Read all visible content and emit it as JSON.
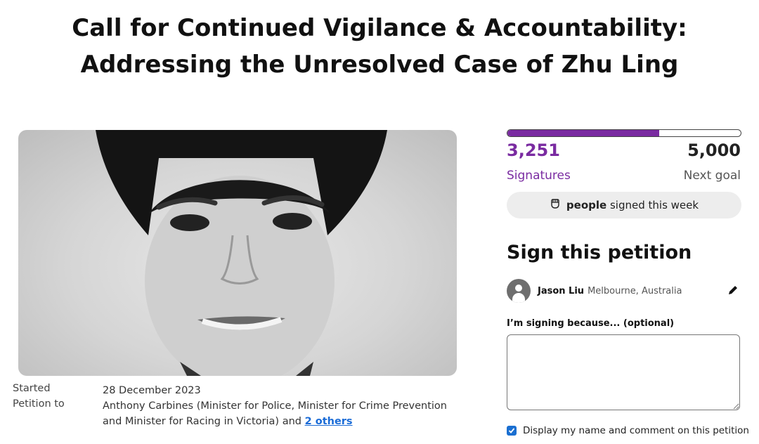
{
  "title": "Call for Continued Vigilance & Accountability: Addressing the Unresolved Case of Zhu Ling",
  "meta": {
    "started_label": "Started",
    "started_value": "28 December 2023",
    "petition_to_label": "Petition to",
    "petition_to_value": "Anthony Carbines (Minister for Police, Minister for Crime Prevention and Minister for Racing in Victoria) and",
    "others_link": "2 others"
  },
  "progress": {
    "signatures": "3,251",
    "signatures_label": "Signatures",
    "goal": "5,000",
    "goal_label": "Next goal",
    "fraction": 0.65,
    "accent_color": "#7a2ba1"
  },
  "week": {
    "icon": "fist-icon",
    "bold": "people",
    "rest": "signed this week"
  },
  "sign": {
    "heading": "Sign this petition",
    "user_name": "Jason Liu",
    "user_location": "Melbourne, Australia",
    "reason_label": "I’m signing because... (optional)",
    "reason_value": "",
    "display_label": "Display my name and comment on this petition",
    "display_checked": true
  }
}
